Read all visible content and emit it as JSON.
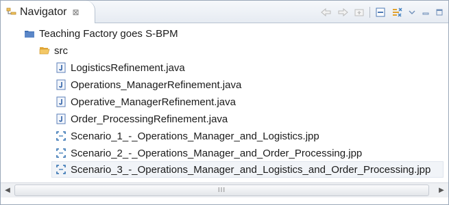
{
  "view": {
    "title": "Navigator",
    "close_glyph": "⊠",
    "title_icon": "navigator-icon"
  },
  "toolbar": {
    "buttons": [
      {
        "name": "back-icon"
      },
      {
        "name": "forward-icon"
      },
      {
        "name": "up-folder-icon"
      },
      {
        "name": "collapse-all-icon"
      },
      {
        "name": "link-with-editor-icon"
      },
      {
        "name": "view-menu-icon"
      },
      {
        "name": "minimize-icon"
      },
      {
        "name": "maximize-icon"
      }
    ]
  },
  "tree": {
    "project": {
      "label": "Teaching Factory goes S-BPM",
      "icon": "project-folder-icon"
    },
    "folder": {
      "label": "src",
      "icon": "open-folder-icon"
    },
    "files": [
      {
        "label": "LogisticsRefinement.java",
        "icon": "java-file-icon"
      },
      {
        "label": "Operations_ManagerRefinement.java",
        "icon": "java-file-icon"
      },
      {
        "label": "Operative_ManagerRefinement.java",
        "icon": "java-file-icon"
      },
      {
        "label": "Order_ProcessingRefinement.java",
        "icon": "java-file-icon"
      },
      {
        "label": "Scenario_1_-_Operations_Manager_and_Logistics.jpp",
        "icon": "process-file-icon"
      },
      {
        "label": "Scenario_2_-_Operations_Manager_and_Order_Processing.jpp",
        "icon": "process-file-icon"
      },
      {
        "label": "Scenario_3_-_Operations_Manager_and_Logistics_and_Order_Processing.jpp",
        "icon": "process-file-icon"
      }
    ],
    "selected_index": 6
  },
  "scrollbar": {
    "left_arrow": "◀",
    "right_arrow": "▶",
    "thumb_grip": "III"
  },
  "colors": {
    "java": "#5b7fb8",
    "process": "#2f6fb0",
    "folder": "#e7b34a",
    "project": "#3f6fb4"
  }
}
